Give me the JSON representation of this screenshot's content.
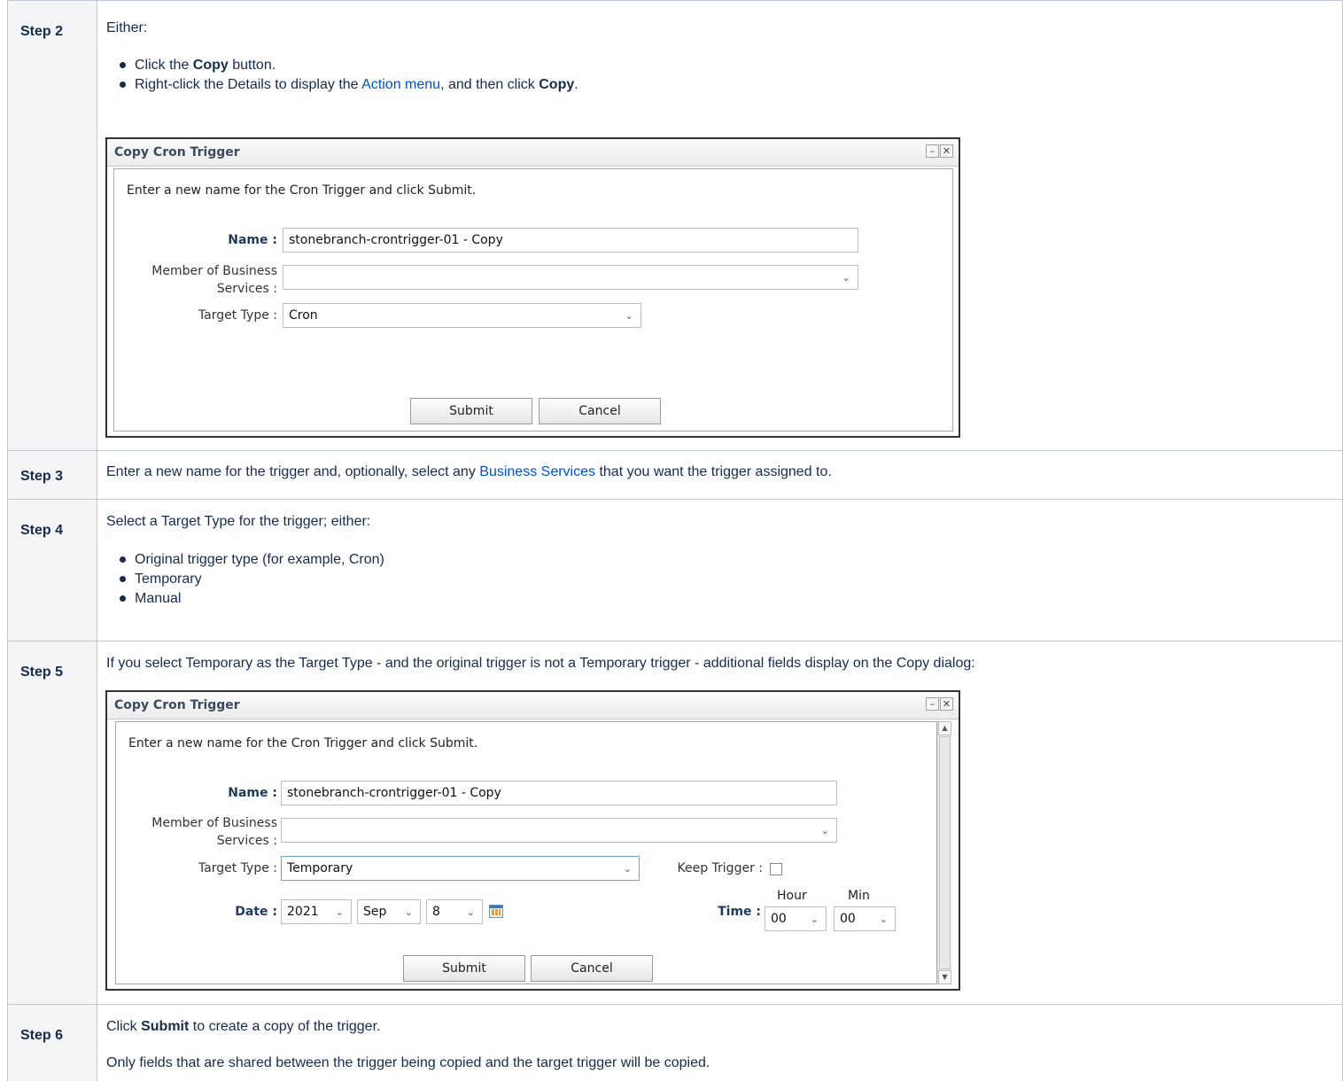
{
  "steps": [
    {
      "label": "Step 2"
    },
    {
      "label": "Step 3"
    },
    {
      "label": "Step 4"
    },
    {
      "label": "Step 5"
    },
    {
      "label": "Step 6"
    }
  ],
  "step2": {
    "intro": "Either:",
    "bullet1": {
      "pre": "Click the ",
      "bold": "Copy",
      "post": " button."
    },
    "bullet2": {
      "pre": "Right-click the Details to display the ",
      "link": "Action menu",
      "mid": ", and then click ",
      "bold": "Copy",
      "post": "."
    }
  },
  "step3": {
    "pre": "Enter a new name for the trigger and, optionally, select any ",
    "link": "Business Services",
    "post": " that you want the trigger assigned to."
  },
  "step4": {
    "intro": "Select a Target Type for the trigger; either:",
    "items": [
      "Original trigger type (for example, Cron)",
      "Temporary",
      "Manual"
    ]
  },
  "step5": {
    "text": "If you select Temporary as the Target Type - and the original trigger is not a Temporary trigger - additional fields display on the Copy dialog:"
  },
  "step6": {
    "pre": "Click ",
    "bold": "Submit",
    "post": " to create a copy of the trigger.",
    "note": "Only fields that are shared between the trigger being copied and the target trigger will be copied."
  },
  "dialog1": {
    "title": "Copy Cron Trigger",
    "minimize": "–",
    "close": "✕",
    "instructions": "Enter a new name for the Cron Trigger and click Submit.",
    "name_label": "Name :",
    "name_value": "stonebranch-crontrigger-01 - Copy",
    "member_label_1": "Member of Business",
    "member_label_2": "Services :",
    "member_value": "",
    "target_label": "Target Type :",
    "target_value": "Cron",
    "submit": "Submit",
    "cancel": "Cancel"
  },
  "dialog2": {
    "title": "Copy Cron Trigger",
    "minimize": "–",
    "close": "✕",
    "instructions": "Enter a new name for the Cron Trigger and click Submit.",
    "name_label": "Name :",
    "name_value": "stonebranch-crontrigger-01 - Copy",
    "member_label_1": "Member of Business",
    "member_label_2": "Services :",
    "member_value": "",
    "target_label": "Target Type :",
    "target_value": "Temporary",
    "keep_label": "Keep Trigger :",
    "keep_checked": false,
    "date_label": "Date :",
    "year": "2021",
    "month": "Sep",
    "day": "8",
    "time_label": "Time :",
    "hour_label": "Hour",
    "min_label": "Min",
    "hour": "00",
    "minute": "00",
    "submit": "Submit",
    "cancel": "Cancel"
  },
  "icons": {
    "chevron": "chevron-down-icon",
    "calendar": "calendar-icon",
    "bullet": "bullet-icon"
  }
}
